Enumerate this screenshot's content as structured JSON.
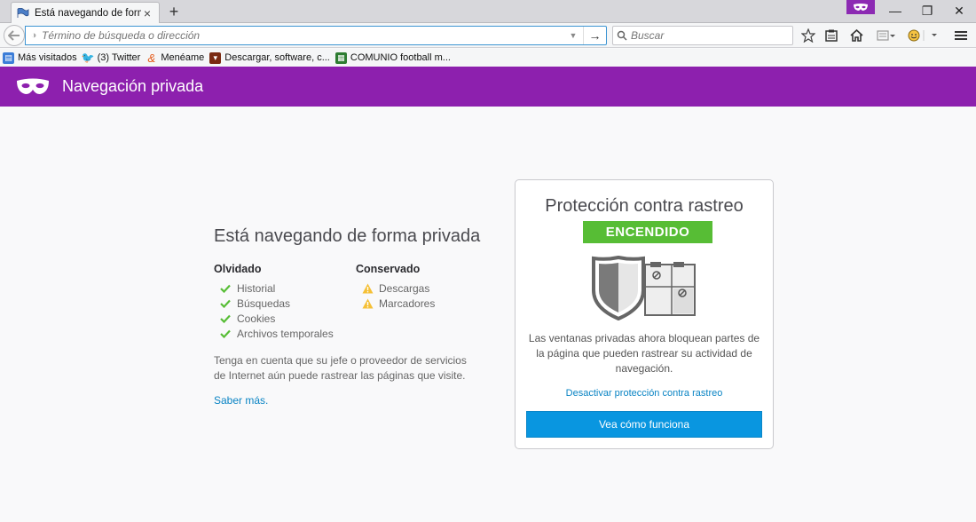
{
  "tab": {
    "title": "Está navegando de forma ...",
    "close": "×"
  },
  "newtab": "+",
  "window": {
    "minimize": "—",
    "restore": "❐",
    "close": "✕"
  },
  "urlbar": {
    "placeholder": "Término de búsqueda o dirección",
    "go": "→"
  },
  "search": {
    "placeholder": "Buscar"
  },
  "bookmarks": [
    {
      "label": "Más visitados",
      "icon": "most-visited-icon",
      "color": "#3b7dd8"
    },
    {
      "label": "(3) Twitter",
      "icon": "twitter-icon",
      "color": "#1da1f2"
    },
    {
      "label": "Menéame",
      "icon": "meneame-icon",
      "color": "#e35614"
    },
    {
      "label": "Descargar, software, c...",
      "icon": "softonic-icon",
      "color": "#c0392b"
    },
    {
      "label": "COMUNIO football m...",
      "icon": "comunio-icon",
      "color": "#2e7d32"
    }
  ],
  "header": {
    "title": "Navegación privada",
    "color": "#8d20ae"
  },
  "main": {
    "title": "Está navegando de forma privada",
    "forgotten": {
      "heading": "Olvidado",
      "items": [
        "Historial",
        "Búsquedas",
        "Cookies",
        "Archivos temporales"
      ]
    },
    "kept": {
      "heading": "Conservado",
      "items": [
        "Descargas",
        "Marcadores"
      ]
    },
    "note": "Tenga en cuenta que su jefe o proveedor de servicios de Internet aún puede rastrear las páginas que visite.",
    "learn_more": "Saber más."
  },
  "tracking": {
    "title": "Protección contra rastreo",
    "status": "ENCENDIDO",
    "status_color": "#57bd35",
    "description": "Las ventanas privadas ahora bloquean partes de la página que pueden rastrear su actividad de navegación.",
    "deactivate": "Desactivar protección contra rastreo",
    "button": "Vea cómo funciona",
    "button_color": "#0996e0"
  }
}
